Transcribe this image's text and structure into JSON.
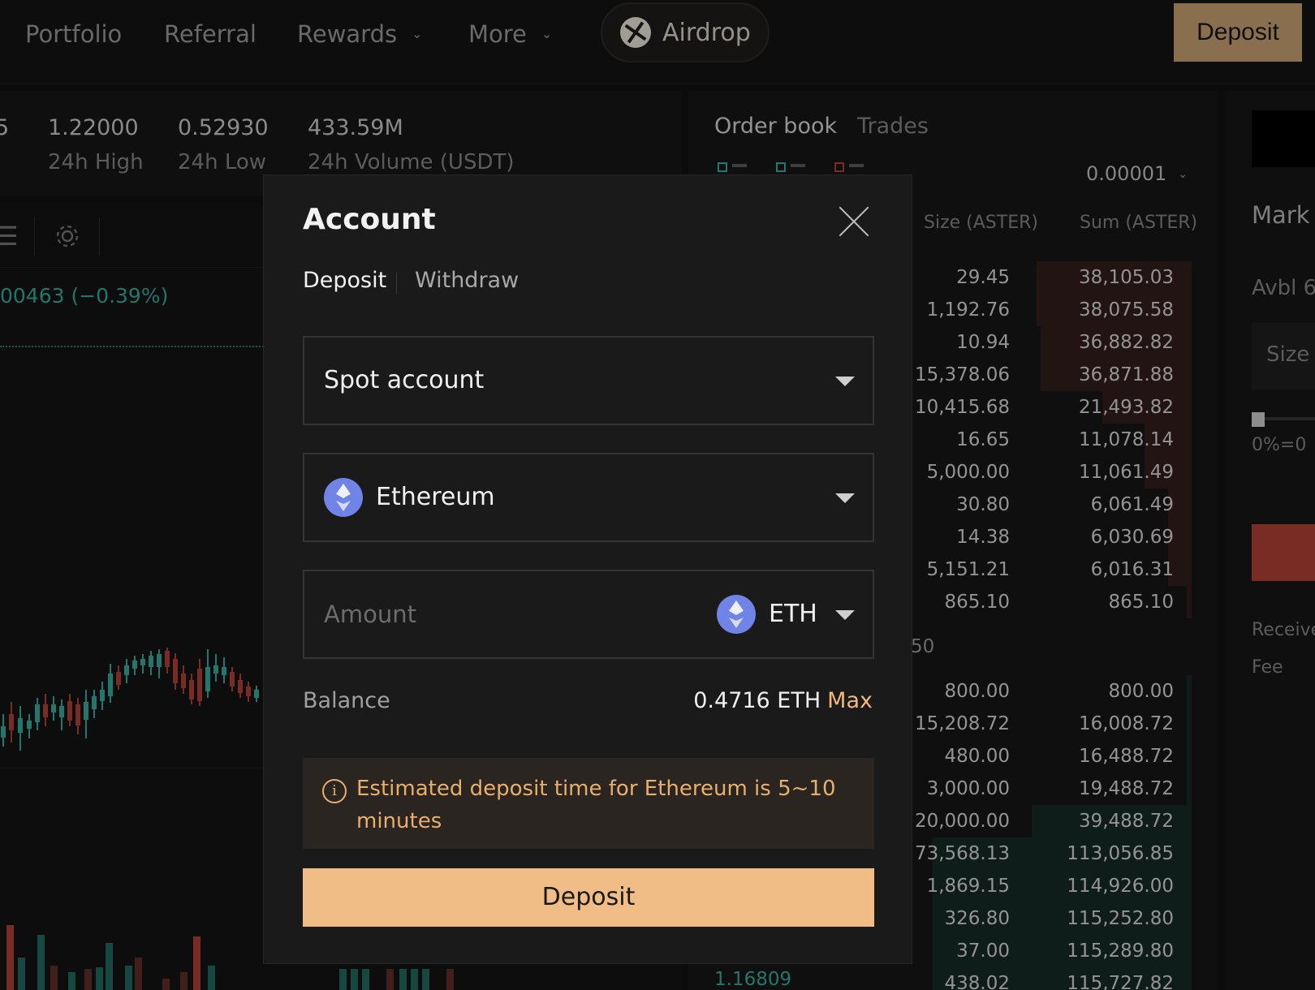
{
  "nav": {
    "items": [
      "Portfolio",
      "Referral",
      "Rewards",
      "More"
    ],
    "airdrop_label": "Airdrop",
    "deposit_label": "Deposit"
  },
  "ticker": {
    "cut_value": "5",
    "high": {
      "value": "1.22000",
      "label": "24h High"
    },
    "low": {
      "value": "0.52930",
      "label": "24h Low"
    },
    "volume": {
      "value": "433.59M",
      "label": "24h Volume (USDT)"
    }
  },
  "chart": {
    "price_change": "00463 (−0.39%)"
  },
  "orderbook": {
    "tabs": [
      "Order book",
      "Trades"
    ],
    "tick_size": "0.00001",
    "headers": {
      "size": "Size (ASTER)",
      "sum": "Sum (ASTER)"
    },
    "asks": [
      {
        "size": "29.45",
        "sum": "38,105.03",
        "depth": 0.33
      },
      {
        "size": "1,192.76",
        "sum": "38,075.58",
        "depth": 0.33
      },
      {
        "size": "10.94",
        "sum": "36,882.82",
        "depth": 0.32
      },
      {
        "size": "15,378.06",
        "sum": "36,871.88",
        "depth": 0.32
      },
      {
        "size": "10,415.68",
        "sum": "21,493.82",
        "depth": 0.19
      },
      {
        "size": "16.65",
        "sum": "11,078.14",
        "depth": 0.1
      },
      {
        "size": "5,000.00",
        "sum": "11,061.49",
        "depth": 0.1
      },
      {
        "size": "30.80",
        "sum": "6,061.49",
        "depth": 0.05
      },
      {
        "size": "14.38",
        "sum": "6,030.69",
        "depth": 0.05
      },
      {
        "size": "5,151.21",
        "sum": "6,016.31",
        "depth": 0.05
      },
      {
        "size": "865.10",
        "sum": "865.10",
        "depth": 0.01
      }
    ],
    "mid_partial": "50",
    "bids": [
      {
        "size": "800.00",
        "sum": "800.00",
        "depth": 0.01
      },
      {
        "size": "15,208.72",
        "sum": "16,008.72",
        "depth": 0.01
      },
      {
        "size": "480.00",
        "sum": "16,488.72",
        "depth": 0.01
      },
      {
        "size": "3,000.00",
        "sum": "19,488.72",
        "depth": 0.01
      },
      {
        "size": "20,000.00",
        "sum": "39,488.72",
        "depth": 0.34
      },
      {
        "size": "73,568.13",
        "sum": "113,056.85",
        "depth": 0.55
      },
      {
        "size": "1,869.15",
        "sum": "114,926.00",
        "depth": 0.55
      },
      {
        "size": "326.80",
        "sum": "115,252.80",
        "depth": 0.55
      },
      {
        "size": "37.00",
        "sum": "115,289.80",
        "depth": 0.55
      },
      {
        "size": "438.02",
        "sum": "115,727.82",
        "depth": 0.55
      }
    ],
    "last_price_partial": "1.16809"
  },
  "trade_panel": {
    "title_partial": "Mark",
    "avbl_partial": "Avbl 6",
    "size_placeholder": "Size",
    "percent_label": "0%=0",
    "receive_label": "Receive",
    "fee_label": "Fee"
  },
  "modal": {
    "title": "Account",
    "tabs": {
      "deposit": "Deposit",
      "withdraw": "Withdraw"
    },
    "account_select": "Spot account",
    "network_select": "Ethereum",
    "amount_placeholder": "Amount",
    "asset": "ETH",
    "balance_label": "Balance",
    "balance_value": "0.4716 ETH",
    "max_label": "Max",
    "notice": "Estimated deposit time for Ethereum is 5~10 minutes",
    "submit_label": "Deposit"
  },
  "colors": {
    "accent": "#f0bd86",
    "up": "#2f9e8f",
    "down": "#a13b2f",
    "notice_text": "#e8ae6b"
  }
}
